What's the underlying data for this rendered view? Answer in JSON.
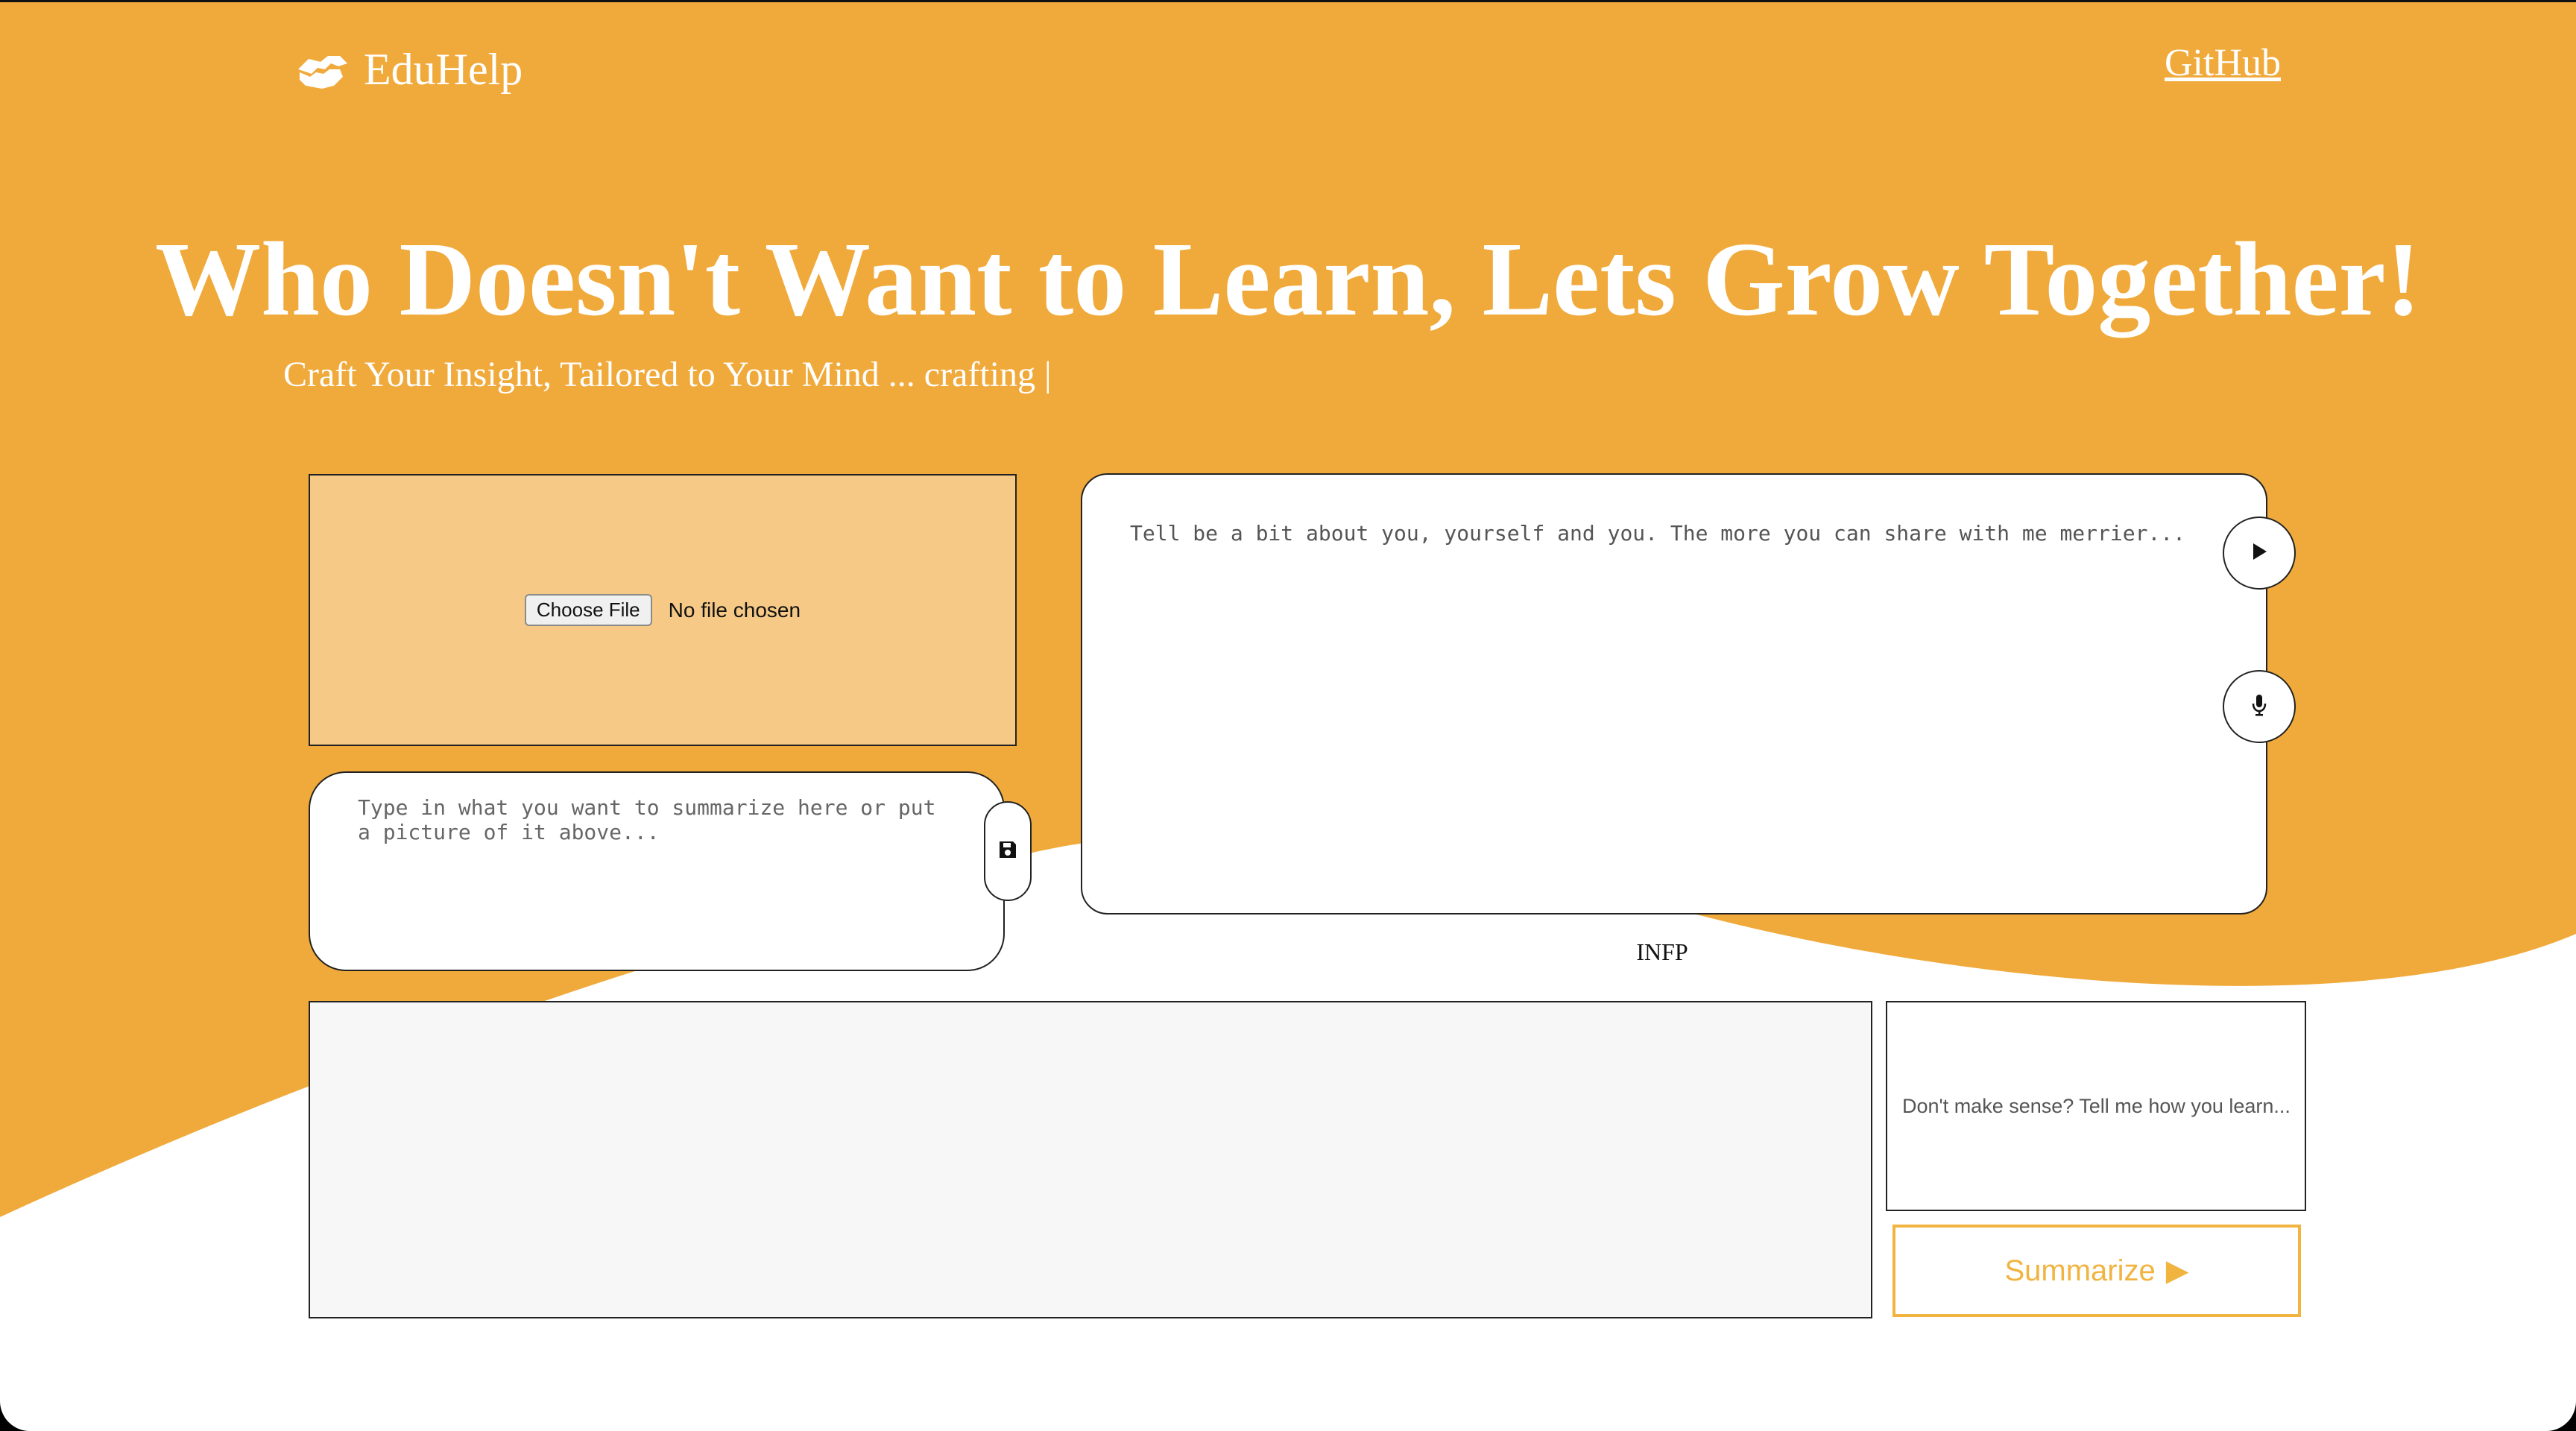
{
  "header": {
    "logo_text": "EduHelp",
    "github_label": "GitHub"
  },
  "hero": {
    "title": "Who Doesn't Want to Learn, Lets Grow Together!",
    "subtitle": "Craft Your Insight, Tailored to Your Mind ... crafting |"
  },
  "upload": {
    "button_label": "Choose File",
    "status_text": "No file chosen"
  },
  "summarize_input": {
    "placeholder": "Type in what you want to summarize here or put a picture of it above...",
    "value": ""
  },
  "about_input": {
    "placeholder": "Tell be a bit about you, yourself and you. The more you can share with me merrier...",
    "value": ""
  },
  "personality": {
    "type": "INFP"
  },
  "output": {
    "text": ""
  },
  "feedback": {
    "placeholder": "Don't make sense? Tell me how you learn..."
  },
  "summarize_button": {
    "label": "Summarize",
    "arrow": "▶"
  },
  "icons": {
    "logo": "handshake-icon",
    "save": "floppy-disk-icon",
    "play": "play-icon",
    "mic": "microphone-icon"
  },
  "colors": {
    "brand_orange": "#f0aa3c",
    "upload_bg": "#f6c986",
    "button_accent": "#f1b440",
    "output_bg": "#f7f7f7"
  }
}
